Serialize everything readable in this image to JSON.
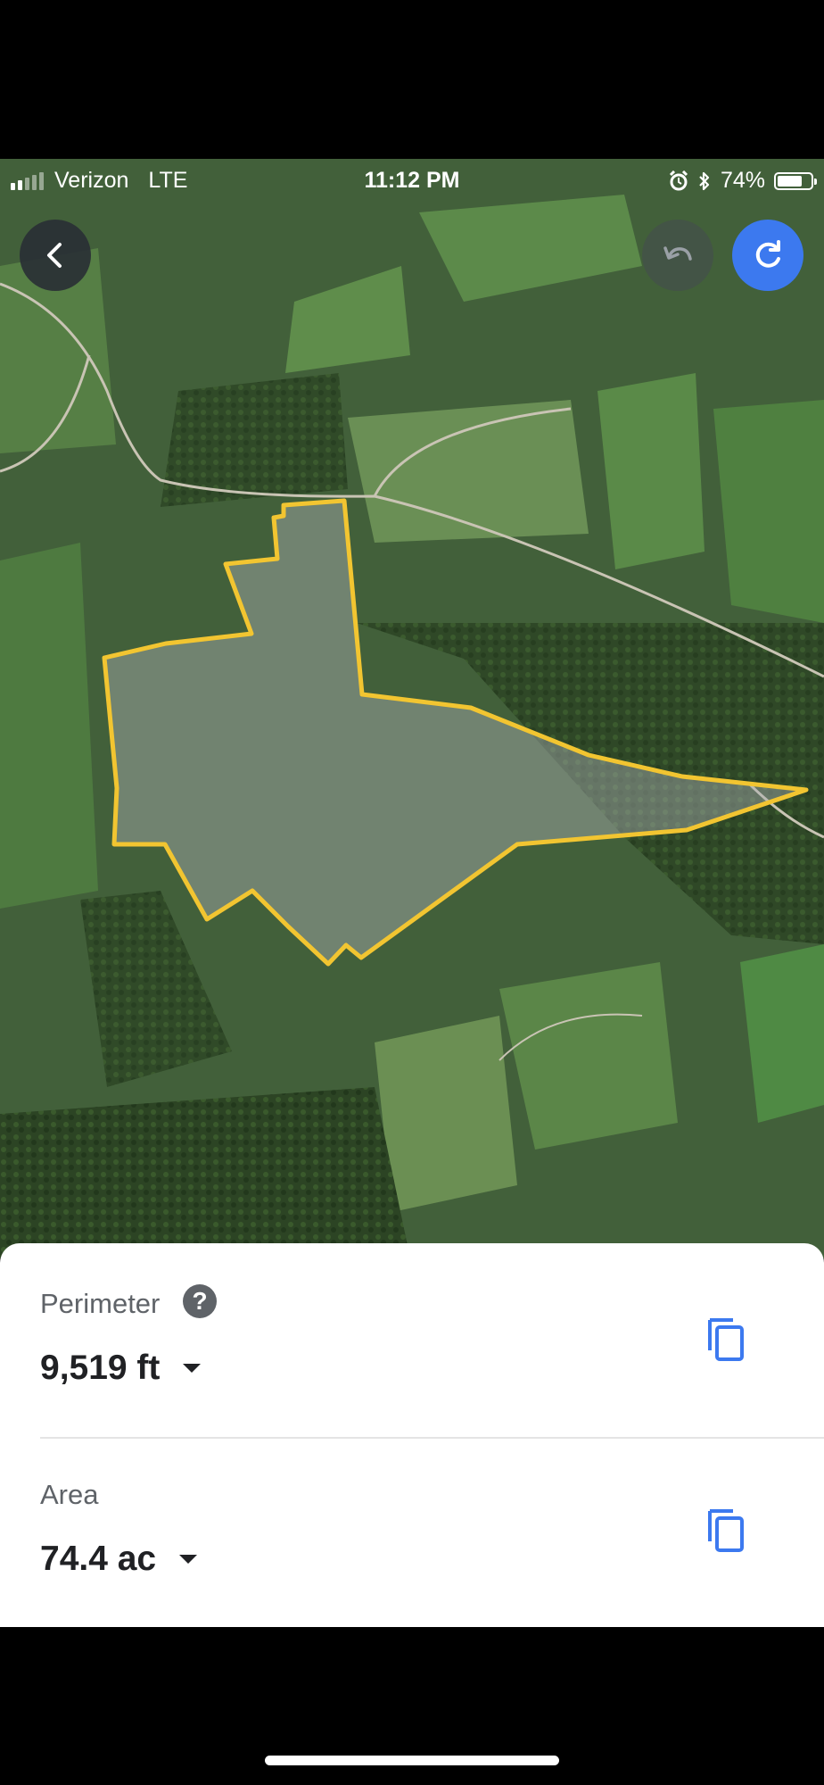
{
  "status_bar": {
    "carrier": "Verizon",
    "network": "LTE",
    "time": "11:12 PM",
    "battery": "74%",
    "battery_level": 0.74,
    "icons": [
      "signal-icon",
      "alarm-icon",
      "bluetooth-icon",
      "battery-icon"
    ]
  },
  "map": {
    "view": "satellite",
    "boundary_color": "#f2c531",
    "fill_color": "rgba(170,175,180,0.45)"
  },
  "controls": {
    "back_icon": "chevron-left-icon",
    "undo_icon": "undo-icon",
    "redo_icon": "redo-icon",
    "accent": "#3c79ef"
  },
  "measurements": {
    "perimeter": {
      "label": "Perimeter",
      "value": "9,519 ft",
      "help": "?"
    },
    "area": {
      "label": "Area",
      "value": "74.4 ac"
    },
    "copy_icon": "copy-icon"
  }
}
